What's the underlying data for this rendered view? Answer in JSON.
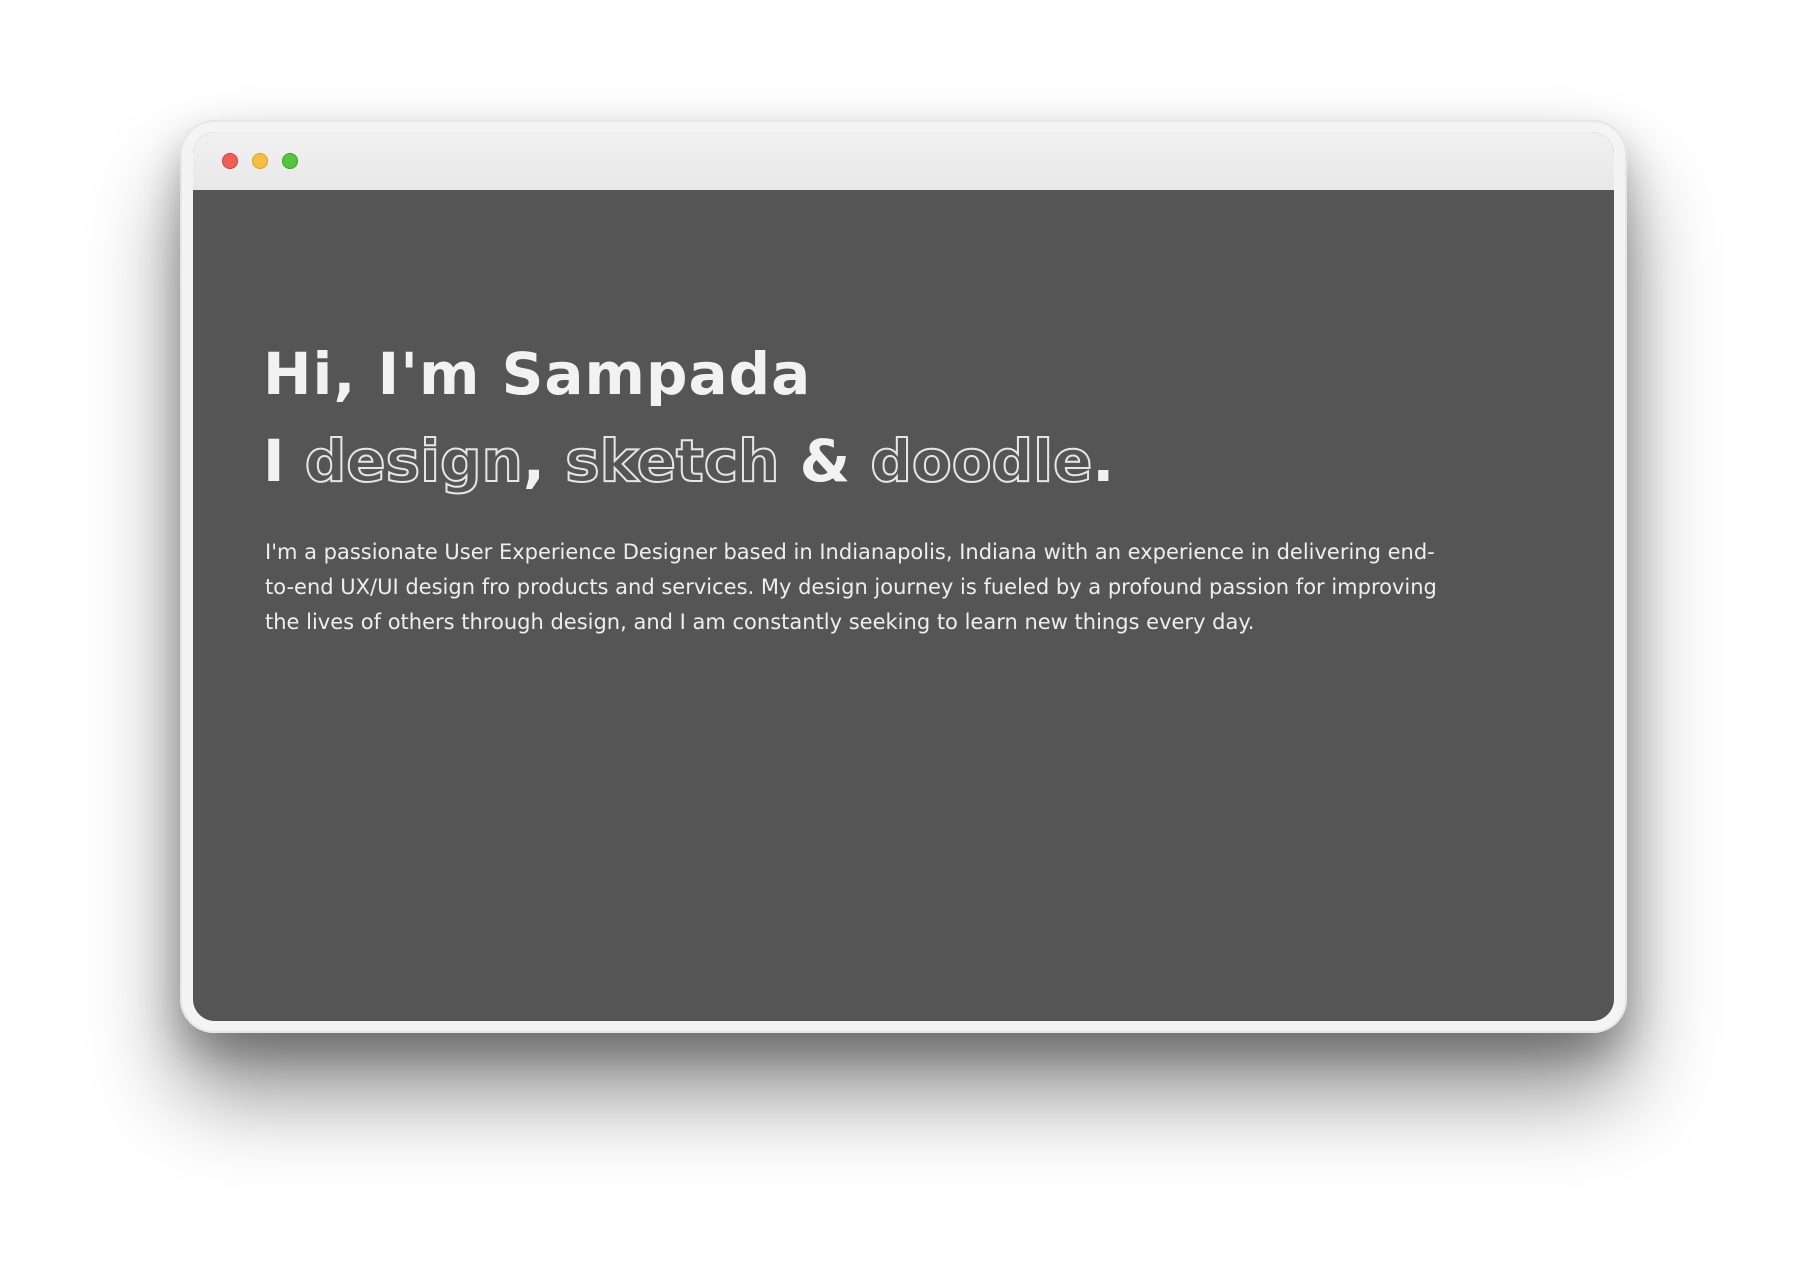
{
  "window": {
    "controls": [
      "close",
      "minimize",
      "maximize"
    ],
    "colors": {
      "close": "#ee5d57",
      "minimize": "#f4be3f",
      "maximize": "#55c440",
      "content_background": "#555555",
      "text": "#f2f2f2"
    }
  },
  "hero": {
    "greeting": "Hi, I'm Sampada",
    "tagline": {
      "prefix": "I ",
      "word1": "design",
      "comma": ", ",
      "word2": "sketch",
      "amp": " & ",
      "word3": "doodle",
      "period": "."
    },
    "bio": "I'm a passionate User Experience Designer based in Indianapolis, Indiana with an experience in delivering end-to-end UX/UI design fro products and services. My design journey is fueled by a profound passion for improving the lives of others through design, and I am constantly seeking to learn new things every day."
  }
}
